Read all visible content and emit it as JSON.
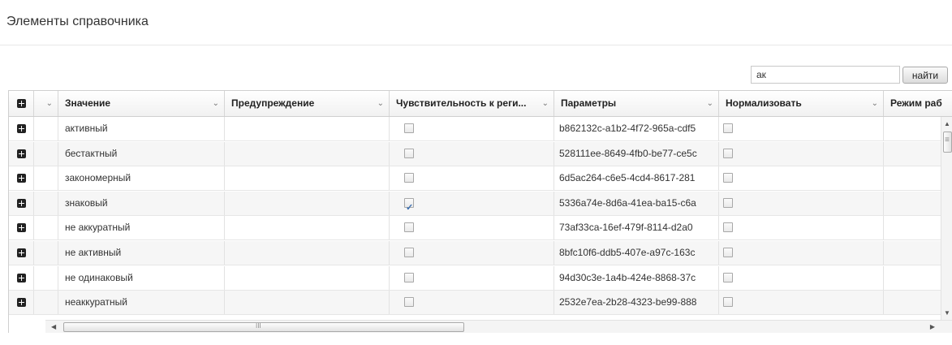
{
  "page_title": "Элементы справочника",
  "search": {
    "value": "ак",
    "button_label": "найти"
  },
  "grid": {
    "columns": [
      {
        "id": "expand",
        "label": ""
      },
      {
        "id": "menu",
        "label": ""
      },
      {
        "id": "value",
        "label": "Значение"
      },
      {
        "id": "warning",
        "label": "Предупреждение"
      },
      {
        "id": "case_sensitivity",
        "label": "Чувствительность к реги..."
      },
      {
        "id": "params",
        "label": "Параметры"
      },
      {
        "id": "normalize",
        "label": "Нормализовать"
      },
      {
        "id": "mode",
        "label": "Режим раб"
      }
    ],
    "rows": [
      {
        "value": "активный",
        "warning": "",
        "case_sensitive": false,
        "params": "b862132c-a1b2-4f72-965a-cdf5",
        "normalize": false
      },
      {
        "value": "бестактный",
        "warning": "",
        "case_sensitive": false,
        "params": "528111ee-8649-4fb0-be77-ce5c",
        "normalize": false
      },
      {
        "value": "закономерный",
        "warning": "",
        "case_sensitive": false,
        "params": "6d5ac264-c6e5-4cd4-8617-281",
        "normalize": false
      },
      {
        "value": "знаковый",
        "warning": "",
        "case_sensitive": true,
        "params": "5336a74e-8d6a-41ea-ba15-c6a",
        "normalize": false
      },
      {
        "value": "не аккуратный",
        "warning": "",
        "case_sensitive": false,
        "params": "73af33ca-16ef-479f-8114-d2a0",
        "normalize": false
      },
      {
        "value": "не активный",
        "warning": "",
        "case_sensitive": false,
        "params": "8bfc10f6-ddb5-407e-a97c-163c",
        "normalize": false
      },
      {
        "value": "не одинаковый",
        "warning": "",
        "case_sensitive": false,
        "params": "94d30c3e-1a4b-424e-8868-37c",
        "normalize": false
      },
      {
        "value": "неаккуратный",
        "warning": "",
        "case_sensitive": false,
        "params": "2532e7ea-2b28-4323-be99-888",
        "normalize": false
      }
    ]
  },
  "icons": {
    "expand": "plus-square-icon",
    "column_menu": "chevron-down-icon",
    "scroll_up": "arrow-up-icon",
    "scroll_down": "arrow-down-icon",
    "scroll_left": "arrow-left-icon",
    "scroll_right": "arrow-right-icon"
  },
  "colors": {
    "header_bg": "#f1f1f1",
    "row_alt_bg": "#f6f6f6",
    "check_color": "#3a6db0"
  }
}
